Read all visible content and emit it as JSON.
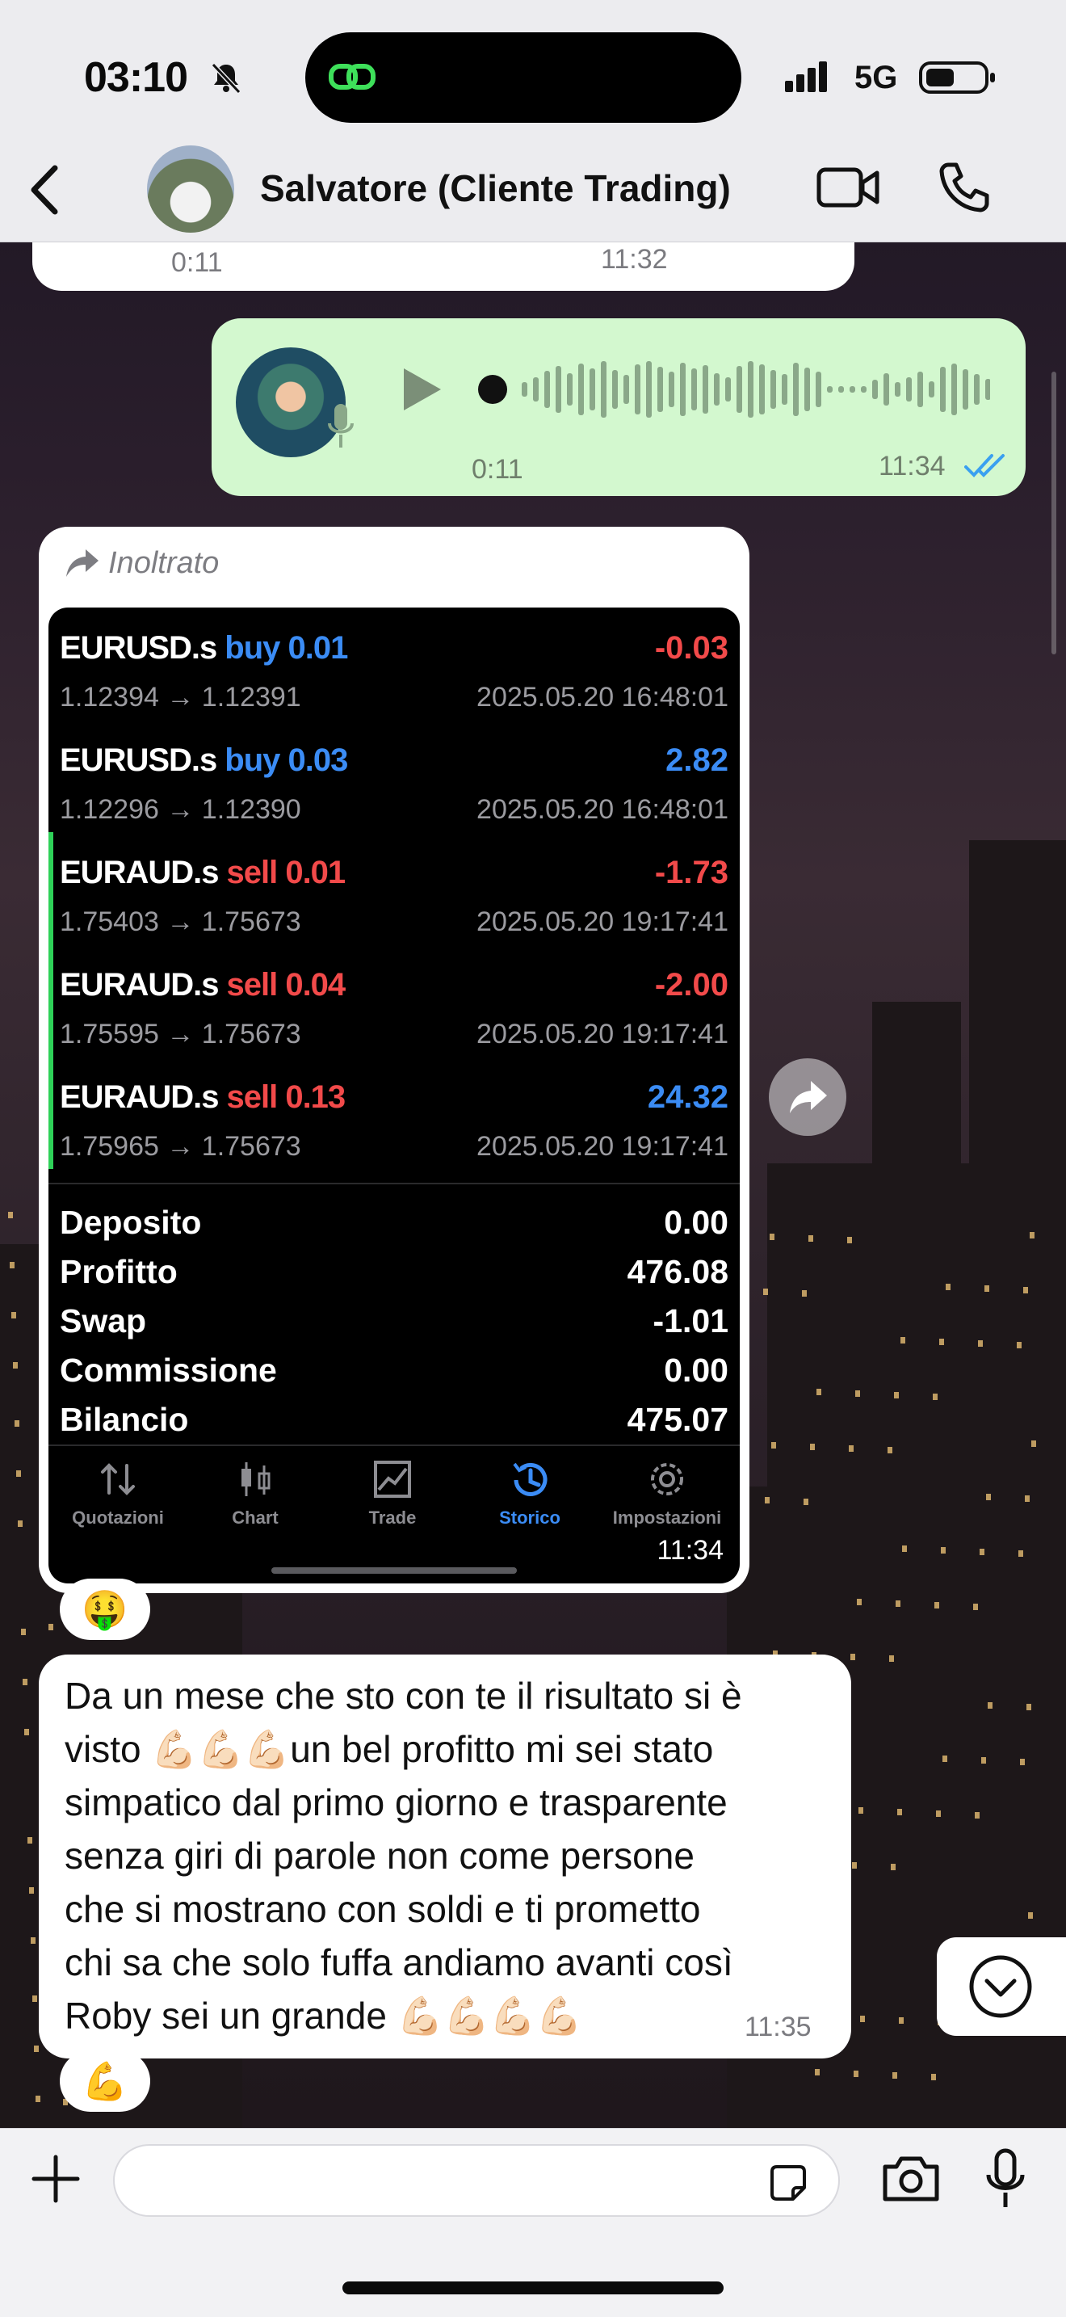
{
  "status_bar": {
    "time": "03:10",
    "network": "5G"
  },
  "header": {
    "contact_name": "Salvatore (Cliente Trading)"
  },
  "previous_message": {
    "duration": "0:11",
    "time": "11:32"
  },
  "voice_message": {
    "duration": "0:11",
    "time": "11:34"
  },
  "forwarded": {
    "label": "Inoltrato",
    "time": "11:34",
    "trades": [
      {
        "symbol": "EURUSD.s",
        "side": "buy 0.01",
        "side_type": "buy",
        "profit": "-0.03",
        "profit_color": "red",
        "prices": "1.12394 → 1.12391",
        "date": "2025.05.20 16:48:01"
      },
      {
        "symbol": "EURUSD.s",
        "side": "buy 0.03",
        "side_type": "buy",
        "profit": "2.82",
        "profit_color": "blue",
        "prices": "1.12296 → 1.12390",
        "date": "2025.05.20 16:48:01"
      },
      {
        "symbol": "EURAUD.s",
        "side": "sell 0.01",
        "side_type": "sell",
        "profit": "-1.73",
        "profit_color": "red",
        "prices": "1.75403 → 1.75673",
        "date": "2025.05.20 19:17:41"
      },
      {
        "symbol": "EURAUD.s",
        "side": "sell 0.04",
        "side_type": "sell",
        "profit": "-2.00",
        "profit_color": "red",
        "prices": "1.75595 → 1.75673",
        "date": "2025.05.20 19:17:41"
      },
      {
        "symbol": "EURAUD.s",
        "side": "sell 0.13",
        "side_type": "sell",
        "profit": "24.32",
        "profit_color": "blue",
        "prices": "1.75965 → 1.75673",
        "date": "2025.05.20 19:17:41"
      }
    ],
    "summary": [
      {
        "label": "Deposito",
        "value": "0.00"
      },
      {
        "label": "Profitto",
        "value": "476.08"
      },
      {
        "label": "Swap",
        "value": "-1.01"
      },
      {
        "label": "Commissione",
        "value": "0.00"
      },
      {
        "label": "Bilancio",
        "value": "475.07"
      }
    ],
    "tabs": [
      {
        "label": "Quotazioni",
        "icon": "arrows-updown-icon",
        "active": false
      },
      {
        "label": "Chart",
        "icon": "candles-icon",
        "active": false
      },
      {
        "label": "Trade",
        "icon": "trend-chart-icon",
        "active": false
      },
      {
        "label": "Storico",
        "icon": "history-clock-icon",
        "active": true
      },
      {
        "label": "Impostazioni",
        "icon": "gear-icon",
        "active": false
      }
    ]
  },
  "reactions": {
    "first": "🤑",
    "second": "💪"
  },
  "text_message": {
    "lines": [
      "Da un mese che sto con te il risultato si è",
      "visto 💪🏻💪🏻💪🏻un bel profitto mi sei stato",
      "simpatico dal primo giorno e trasparente",
      "senza giri di parole non come persone",
      "che si mostrano con soldi e ti prometto",
      "chi sa che solo fuffa andiamo avanti così",
      "Roby sei un grande 💪🏻💪🏻💪🏻💪🏻"
    ],
    "time": "11:35"
  },
  "composer": {
    "placeholder": ""
  },
  "colors": {
    "outgoing_bubble": "#d3f8cf",
    "incoming_bubble": "#ffffff",
    "profit_blue": "#3b8cf5",
    "loss_red": "#f24a4a",
    "read_ticks": "#3aa0f0"
  }
}
